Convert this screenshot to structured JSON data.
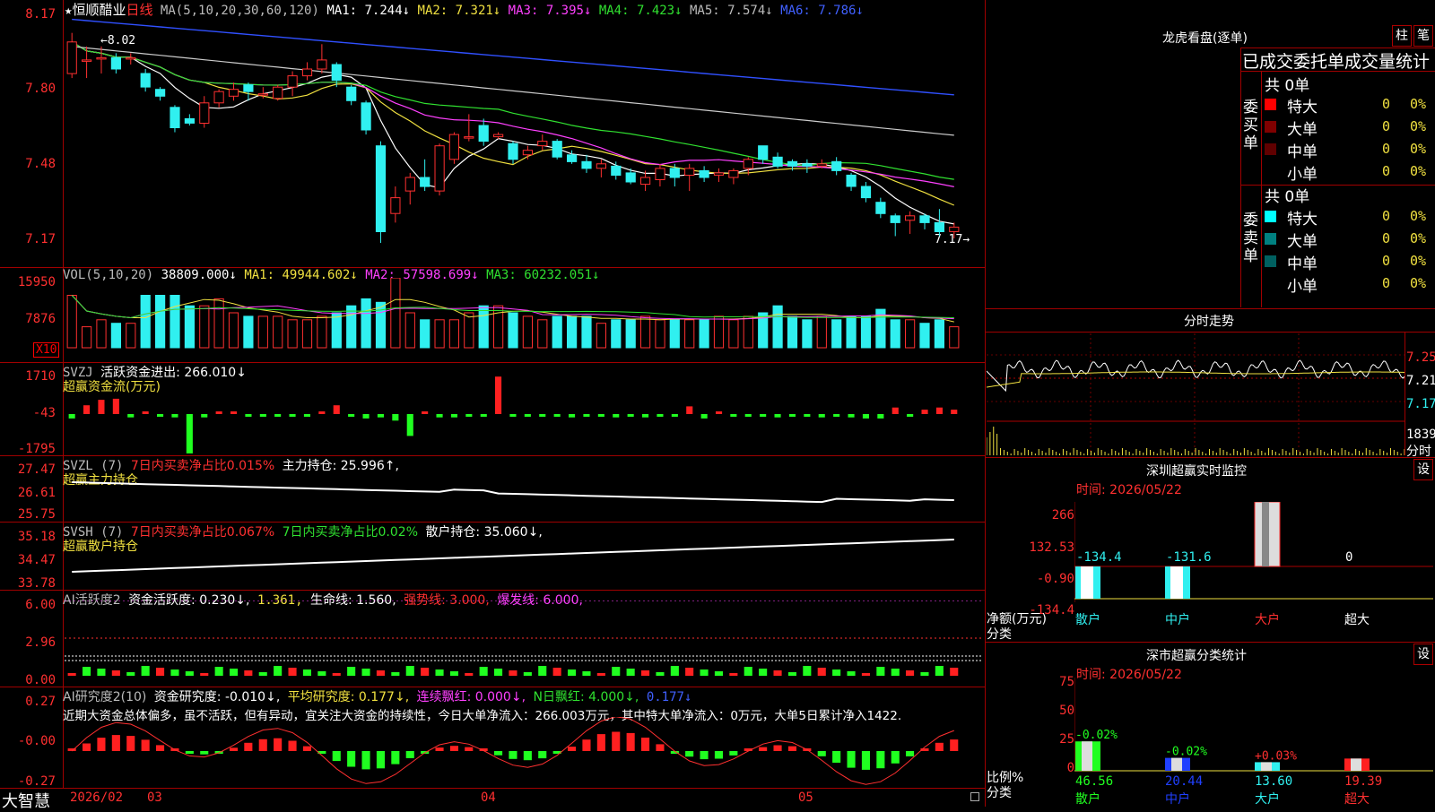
{
  "header": {
    "star": "★",
    "stock_name": "恒顺醋业",
    "period": "日线",
    "ma_label": "MA(5,10,20,30,60,120)",
    "ma1": "MA1: 7.244↓",
    "ma2": "MA2: 7.321↓",
    "ma3": "MA3: 7.395↓",
    "ma4": "MA4: 7.423↓",
    "ma5": "MA5: 7.574↓",
    "ma6": "MA6: 7.786↓"
  },
  "price_axis": [
    "8.17",
    "7.80",
    "7.48",
    "7.17"
  ],
  "price_annotations": {
    "high": "8.02",
    "low": "7.17"
  },
  "vol_header": {
    "label": "VOL(5,10,20)",
    "value": "38809.000↓",
    "ma1": "MA1: 49944.602↓",
    "ma2": "MA2: 57598.699↓",
    "ma3": "MA3: 60232.051↓"
  },
  "vol_axis": [
    "15950",
    "7876",
    "X10"
  ],
  "svzj": {
    "label": "SVZJ",
    "text": "活跃资金进出: 266.010↓",
    "sub": "超赢资金流(万元)",
    "axis": [
      "1710",
      "-43",
      "-1795"
    ]
  },
  "svzl": {
    "label": "SVZL (7)",
    "text1": "7日内买卖净占比0.015%",
    "text2": "主力持仓: 25.996↑,",
    "sub": "超赢主力持仓",
    "axis": [
      "27.47",
      "26.61",
      "25.75"
    ]
  },
  "svsh": {
    "label": "SVSH (7)",
    "text1": "7日内买卖净占比0.067%",
    "text2": "7日内买卖净占比0.02%",
    "text3": "散户持仓: 35.060↓,",
    "sub": "超赢散户持仓",
    "axis": [
      "35.18",
      "34.47",
      "33.78"
    ]
  },
  "ai2": {
    "label": "AI活跃度2",
    "t1": "资金活跃度: 0.230↓,",
    "t2": "1.361,",
    "t3": "生命线: 1.560,",
    "t4": "强势线: 3.000,",
    "t5": "爆发线: 6.000,",
    "axis": [
      "6.00",
      "2.96",
      "0.00"
    ]
  },
  "ai_research": {
    "label": "AI研究度2(10)",
    "t1": "资金研究度: -0.010↓,",
    "t2": "平均研究度: 0.177↓,",
    "t3": "连续飘红: 0.000↓,",
    "t4": "N日飘红: 4.000↓,",
    "t5": "0.177↓",
    "comment": "近期大资金总体偏多，虽不活跃，但有异动，宜关注大资金的持续性，今日大单净流入：266.003万元，其中特大单净流入：0万元，大单5日累计净入1422.",
    "axis": [
      "0.27",
      "-0.00",
      "-0.27"
    ]
  },
  "bottom": {
    "brand": "大智慧",
    "dates": [
      "2026/02",
      "03",
      "04",
      "05"
    ]
  },
  "dragon": {
    "title": "龙虎看盘(逐单)",
    "btn1": "柱",
    "btn2": "笔",
    "subtitle": "已成交委托单成交量统计",
    "buy_label": "委买单",
    "sell_label": "委卖单",
    "buy_total": "共 0单",
    "sell_total": "共 0单",
    "rows": [
      {
        "name": "特大",
        "count": "0",
        "pct": "0%"
      },
      {
        "name": "大单",
        "count": "0",
        "pct": "0%"
      },
      {
        "name": "中单",
        "count": "0",
        "pct": "0%"
      },
      {
        "name": "小单",
        "count": "0",
        "pct": "0%"
      }
    ],
    "colors_buy": [
      "#ff0000",
      "#800000",
      "#600000",
      "#000000"
    ],
    "colors_sell": [
      "#00ffff",
      "#008080",
      "#006060",
      "#000000"
    ]
  },
  "intraday": {
    "title": "分时走势",
    "axis": [
      "7.25",
      "7.21",
      "7.17"
    ],
    "vol_max": "1839",
    "vol_label": "分时"
  },
  "sz_monitor": {
    "title": "深圳超赢实时监控",
    "set": "设",
    "time": "时间: 2026/05/22",
    "axis": [
      "266",
      "132.53",
      "-0.90",
      "-134.4"
    ],
    "ylabel": "净额(万元)",
    "xlabel": "分类",
    "cats": [
      "散户",
      "中户",
      "大户",
      "超大"
    ],
    "values": [
      "-134.4",
      "-131.6",
      "266",
      "0"
    ]
  },
  "sz_class": {
    "title": "深市超赢分类统计",
    "set": "设",
    "time": "时间: 2026/05/22",
    "axis": [
      "75",
      "50",
      "25",
      "0"
    ],
    "ylabel": "比例%",
    "xlabel": "分类",
    "cats": [
      "散户",
      "中户",
      "大户",
      "超大"
    ],
    "values": [
      "46.56",
      "20.44",
      "13.60",
      "19.39"
    ],
    "changes": [
      "-0.02%",
      "-0.02%",
      "+0.03%",
      ""
    ]
  },
  "chart_data": {
    "type": "bar",
    "title": "恒顺醋业",
    "candles": [
      {
        "o": 7.9,
        "c": 8.04,
        "h": 8.08,
        "l": 7.88
      },
      {
        "o": 7.96,
        "c": 7.96,
        "h": 8.02,
        "l": 7.88
      },
      {
        "o": 7.97,
        "c": 7.97,
        "h": 8.02,
        "l": 7.9
      },
      {
        "o": 7.97,
        "c": 7.92,
        "h": 7.99,
        "l": 7.9
      },
      {
        "o": 7.97,
        "c": 7.97,
        "h": 7.99,
        "l": 7.94
      },
      {
        "o": 7.9,
        "c": 7.84,
        "h": 7.92,
        "l": 7.82
      },
      {
        "o": 7.83,
        "c": 7.8,
        "h": 7.84,
        "l": 7.78
      },
      {
        "o": 7.75,
        "c": 7.66,
        "h": 7.76,
        "l": 7.64
      },
      {
        "o": 7.7,
        "c": 7.68,
        "h": 7.72,
        "l": 7.67
      },
      {
        "o": 7.68,
        "c": 7.77,
        "h": 7.8,
        "l": 7.66
      },
      {
        "o": 7.77,
        "c": 7.82,
        "h": 7.83,
        "l": 7.75
      },
      {
        "o": 7.8,
        "c": 7.83,
        "h": 7.86,
        "l": 7.78
      },
      {
        "o": 7.85,
        "c": 7.82,
        "h": 7.86,
        "l": 7.78
      },
      {
        "o": 7.81,
        "c": 7.81,
        "h": 7.84,
        "l": 7.79
      },
      {
        "o": 7.79,
        "c": 7.84,
        "h": 7.85,
        "l": 7.78
      },
      {
        "o": 7.84,
        "c": 7.89,
        "h": 7.91,
        "l": 7.8
      },
      {
        "o": 7.89,
        "c": 7.92,
        "h": 7.95,
        "l": 7.87
      },
      {
        "o": 7.92,
        "c": 7.96,
        "h": 8.03,
        "l": 7.9
      },
      {
        "o": 7.94,
        "c": 7.87,
        "h": 7.95,
        "l": 7.84
      },
      {
        "o": 7.84,
        "c": 7.78,
        "h": 7.85,
        "l": 7.76
      },
      {
        "o": 7.77,
        "c": 7.65,
        "h": 7.78,
        "l": 7.63
      },
      {
        "o": 7.58,
        "c": 7.2,
        "h": 7.6,
        "l": 7.15
      },
      {
        "o": 7.28,
        "c": 7.35,
        "h": 7.4,
        "l": 7.24
      },
      {
        "o": 7.38,
        "c": 7.44,
        "h": 7.46,
        "l": 7.32
      },
      {
        "o": 7.44,
        "c": 7.4,
        "h": 7.52,
        "l": 7.38
      },
      {
        "o": 7.38,
        "c": 7.58,
        "h": 7.59,
        "l": 7.36
      },
      {
        "o": 7.52,
        "c": 7.63,
        "h": 7.64,
        "l": 7.5
      },
      {
        "o": 7.62,
        "c": 7.62,
        "h": 7.72,
        "l": 7.6
      },
      {
        "o": 7.67,
        "c": 7.6,
        "h": 7.7,
        "l": 7.58
      },
      {
        "o": 7.62,
        "c": 7.63,
        "h": 7.64,
        "l": 7.61
      },
      {
        "o": 7.59,
        "c": 7.52,
        "h": 7.6,
        "l": 7.5
      },
      {
        "o": 7.54,
        "c": 7.56,
        "h": 7.58,
        "l": 7.52
      },
      {
        "o": 7.58,
        "c": 7.6,
        "h": 7.63,
        "l": 7.56
      },
      {
        "o": 7.6,
        "c": 7.53,
        "h": 7.61,
        "l": 7.52
      },
      {
        "o": 7.54,
        "c": 7.51,
        "h": 7.56,
        "l": 7.5
      },
      {
        "o": 7.51,
        "c": 7.48,
        "h": 7.54,
        "l": 7.46
      },
      {
        "o": 7.48,
        "c": 7.5,
        "h": 7.52,
        "l": 7.44
      },
      {
        "o": 7.49,
        "c": 7.45,
        "h": 7.51,
        "l": 7.43
      },
      {
        "o": 7.46,
        "c": 7.42,
        "h": 7.48,
        "l": 7.41
      },
      {
        "o": 7.41,
        "c": 7.44,
        "h": 7.47,
        "l": 7.38
      },
      {
        "o": 7.43,
        "c": 7.48,
        "h": 7.5,
        "l": 7.4
      },
      {
        "o": 7.48,
        "c": 7.44,
        "h": 7.5,
        "l": 7.4
      },
      {
        "o": 7.45,
        "c": 7.48,
        "h": 7.5,
        "l": 7.38
      },
      {
        "o": 7.47,
        "c": 7.44,
        "h": 7.49,
        "l": 7.42
      },
      {
        "o": 7.45,
        "c": 7.46,
        "h": 7.48,
        "l": 7.42
      },
      {
        "o": 7.44,
        "c": 7.47,
        "h": 7.48,
        "l": 7.41
      },
      {
        "o": 7.48,
        "c": 7.52,
        "h": 7.53,
        "l": 7.45
      },
      {
        "o": 7.58,
        "c": 7.52,
        "h": 7.58,
        "l": 7.5
      },
      {
        "o": 7.53,
        "c": 7.49,
        "h": 7.55,
        "l": 7.48
      },
      {
        "o": 7.51,
        "c": 7.49,
        "h": 7.52,
        "l": 7.47
      },
      {
        "o": 7.5,
        "c": 7.49,
        "h": 7.52,
        "l": 7.46
      },
      {
        "o": 7.49,
        "c": 7.5,
        "h": 7.52,
        "l": 7.48
      },
      {
        "o": 7.51,
        "c": 7.47,
        "h": 7.53,
        "l": 7.45
      },
      {
        "o": 7.45,
        "c": 7.4,
        "h": 7.46,
        "l": 7.38
      },
      {
        "o": 7.4,
        "c": 7.35,
        "h": 7.42,
        "l": 7.33
      },
      {
        "o": 7.33,
        "c": 7.28,
        "h": 7.35,
        "l": 7.26
      },
      {
        "o": 7.27,
        "c": 7.24,
        "h": 7.28,
        "l": 7.18
      },
      {
        "o": 7.25,
        "c": 7.27,
        "h": 7.29,
        "l": 7.19
      },
      {
        "o": 7.27,
        "c": 7.24,
        "h": 7.28,
        "l": 7.21
      },
      {
        "o": 7.24,
        "c": 7.2,
        "h": 7.3,
        "l": 7.18
      },
      {
        "o": 7.2,
        "c": 7.22,
        "h": 7.24,
        "l": 7.17
      }
    ],
    "volumes": [
      15,
      6,
      8,
      7,
      7,
      15,
      15,
      15,
      12,
      12,
      14,
      10,
      9,
      9,
      9,
      8,
      8,
      9,
      10,
      12,
      14,
      13,
      20,
      10,
      8,
      8,
      8,
      10,
      12,
      12,
      10,
      9,
      8,
      9,
      9,
      9,
      7,
      8,
      8,
      9,
      8,
      8,
      8,
      8,
      9,
      8,
      9,
      10,
      12,
      9,
      8,
      9,
      8,
      9,
      9,
      11,
      8,
      8,
      7,
      8,
      6
    ],
    "svzj_flow": [
      -200,
      400,
      650,
      700,
      -150,
      0,
      -50,
      -150,
      -1795,
      -150,
      0,
      0,
      -100,
      -100,
      -50,
      -100,
      -100,
      0,
      400,
      -50,
      -200,
      -150,
      -300,
      -1000,
      0,
      -150,
      -150,
      -50,
      -50,
      1710,
      -100,
      -50,
      -100,
      -50,
      -150,
      -100,
      -100,
      -150,
      -100,
      -150,
      -100,
      -100,
      350,
      -200,
      0,
      -50,
      -100,
      -100,
      -150,
      -100,
      -50,
      -150,
      -100,
      -150,
      -200,
      -200,
      300,
      -50,
      200,
      300,
      200
    ]
  }
}
